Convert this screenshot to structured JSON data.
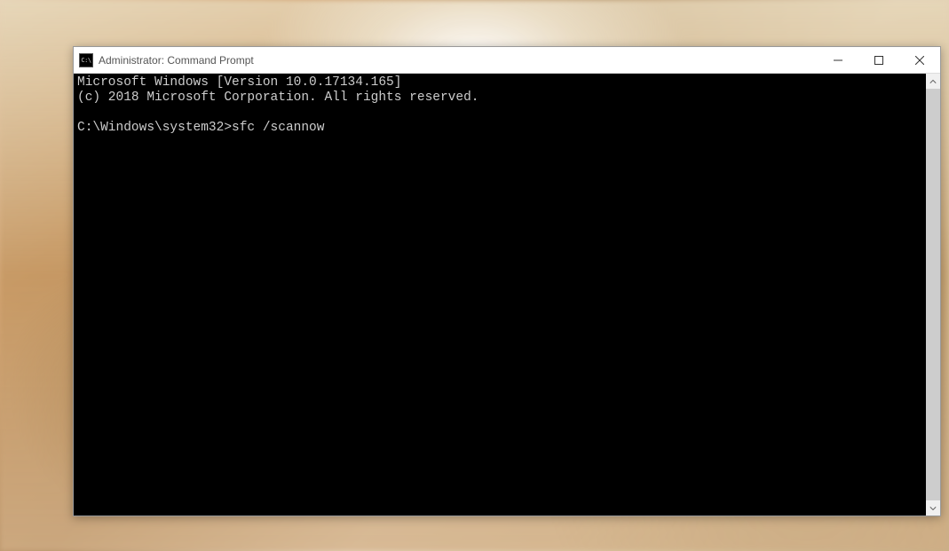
{
  "window": {
    "icon_label": "C:\\",
    "title": "Administrator: Command Prompt"
  },
  "terminal": {
    "line1": "Microsoft Windows [Version 10.0.17134.165]",
    "line2": "(c) 2018 Microsoft Corporation. All rights reserved.",
    "blank": "",
    "prompt": "C:\\Windows\\system32>",
    "command": "sfc /scannow"
  }
}
